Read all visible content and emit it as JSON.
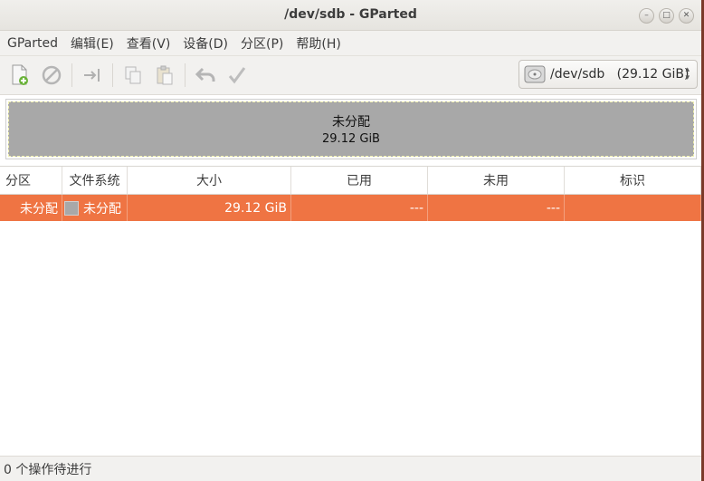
{
  "window": {
    "title": "/dev/sdb - GParted",
    "controls": [
      "–",
      "□",
      "✕"
    ]
  },
  "menu": [
    "GParted",
    "编辑(E)",
    "查看(V)",
    "设备(D)",
    "分区(P)",
    "帮助(H)"
  ],
  "device_selector": {
    "value": "/dev/sdb   (29.12 GiB)"
  },
  "disk_map": {
    "partition_name": "未分配",
    "partition_size": "29.12 GiB"
  },
  "table": {
    "headers": [
      "分区",
      "文件系统",
      "大小",
      "已用",
      "未用",
      "标识"
    ],
    "rows": [
      {
        "partition": "未分配",
        "filesystem": "未分配",
        "size": "29.12 GiB",
        "used": "---",
        "unused": "---",
        "flags": ""
      }
    ]
  },
  "status": {
    "text": "0 个操作待进行"
  },
  "colors": {
    "selection": "#ef7443",
    "unallocated": "#a8a8a8"
  }
}
